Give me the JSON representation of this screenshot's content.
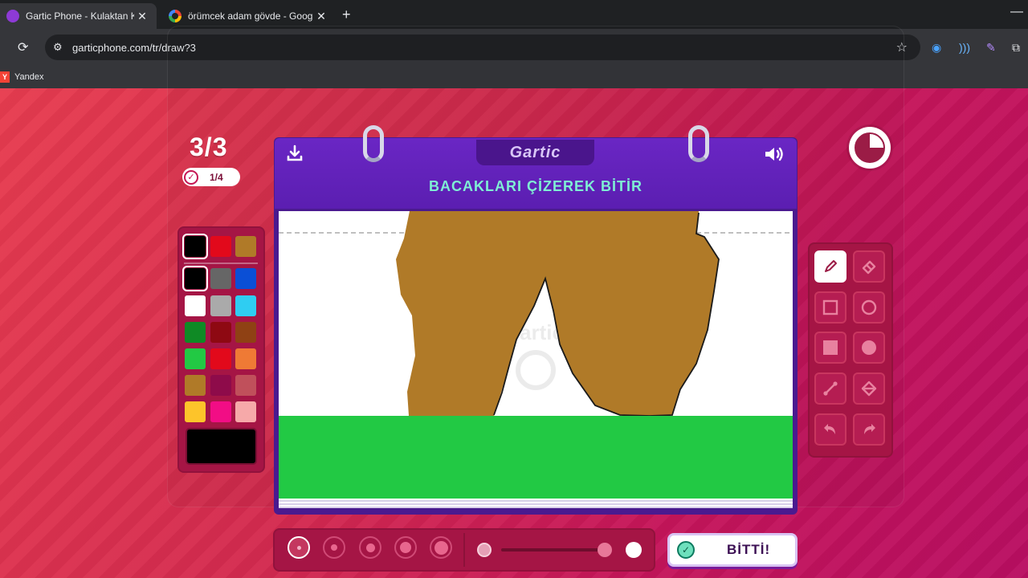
{
  "browser": {
    "tabs": [
      {
        "title": "Gartic Phone - Kulaktan Kulağa",
        "active": true
      },
      {
        "title": "örümcek adam gövde - Google",
        "active": false
      }
    ],
    "url": "garticphone.com/tr/draw?3",
    "bookmarks": [
      {
        "label": "Yandex"
      }
    ]
  },
  "game": {
    "round": "3/3",
    "progress": "1/4",
    "brand": "Gartic",
    "instruction": "BACAKLARI ÇİZEREK BİTİR",
    "done_label": "BİTTİ!",
    "timer_remaining_fraction": 0.75,
    "palette": {
      "primary": [
        "#000000",
        "#e2091b",
        "#b07a28"
      ],
      "grid": [
        [
          "#000000",
          "#666666",
          "#0a4fd6"
        ],
        [
          "#ffffff",
          "#aaaaaa",
          "#2fcdf2"
        ],
        [
          "#0f8a25",
          "#8e0912",
          "#8f4114"
        ],
        [
          "#22c944",
          "#e2091b",
          "#ef7a35"
        ],
        [
          "#b07a28",
          "#8e0b4a",
          "#c0505b"
        ],
        [
          "#fdc42a",
          "#f20d85",
          "#f6a9a9"
        ]
      ],
      "selected": "#000000",
      "current": "#000000"
    },
    "tools": [
      {
        "name": "pencil",
        "selected": true
      },
      {
        "name": "eraser",
        "selected": false
      },
      {
        "name": "rectangle-outline",
        "selected": false
      },
      {
        "name": "circle-outline",
        "selected": false
      },
      {
        "name": "rectangle-filled",
        "selected": false
      },
      {
        "name": "circle-filled",
        "selected": false
      },
      {
        "name": "line",
        "selected": false
      },
      {
        "name": "fill-bucket",
        "selected": false
      },
      {
        "name": "undo",
        "selected": false
      },
      {
        "name": "redo",
        "selected": false
      }
    ],
    "brush_sizes": [
      1,
      2,
      3,
      4,
      5
    ],
    "brush_size_selected": 1,
    "opacity_fraction": 0.95,
    "canvas": {
      "ground_color": "#22c944",
      "figure_color": "#b07a28",
      "background": "#ffffff"
    }
  }
}
